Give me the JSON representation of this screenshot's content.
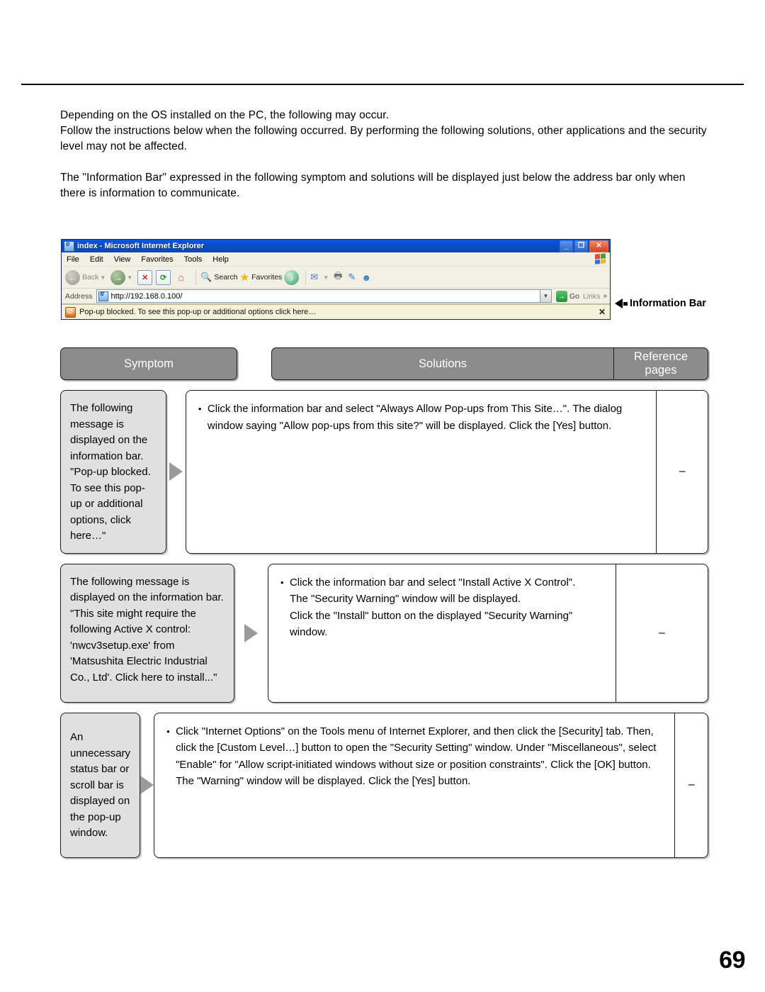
{
  "page": {
    "number": "69"
  },
  "intro": {
    "line1": "Depending on the OS installed on the PC, the following may occur.",
    "line2": "Follow the instructions below when the following occurred. By performing the following solutions, other applications and the security level may not be affected.",
    "line3": "The \"Information Bar\" expressed in the following symptom and solutions will be displayed just below the address bar only when there is information to communicate."
  },
  "browser": {
    "title": "index - Microsoft Internet Explorer",
    "window_buttons": {
      "minimize": "_",
      "restore": "❐",
      "close": "✕"
    },
    "menu": [
      "File",
      "Edit",
      "View",
      "Favorites",
      "Tools",
      "Help"
    ],
    "toolbar": {
      "back": "Back",
      "forward": "",
      "stop": "✕",
      "refresh": "⟳",
      "home": "⌂",
      "search": "Search",
      "favorites": "Favorites",
      "media": "",
      "mail": "✉",
      "print": "🖶",
      "edit": "✎",
      "messenger": "☻"
    },
    "address": {
      "label": "Address",
      "url": "http://192.168.0.100/",
      "dropdown": "▼",
      "go": "Go",
      "go_arrow": "→",
      "links": "Links",
      "chevron": "»"
    },
    "information_bar": {
      "message": "Pop-up blocked. To see this pop-up or additional options click here…",
      "close": "✕"
    }
  },
  "callout": {
    "label": "Information Bar"
  },
  "table": {
    "headers": {
      "symptom": "Symptom",
      "solutions": "Solutions",
      "reference_line1": "Reference",
      "reference_line2": "pages"
    },
    "rows": [
      {
        "symptom": "The following message is displayed on the information bar.\n\"Pop-up blocked. To see this pop-up or additional options, click here…\"",
        "solution": "Click the information bar and select \"Always Allow Pop-ups from This Site…\". The dialog window saying \"Allow pop-ups from this site?\" will be displayed. Click the [Yes] button.",
        "reference": "–"
      },
      {
        "symptom": "The following message is displayed on the information bar. \"This site might require the following Active X control: 'nwcv3setup.exe' from 'Matsushita Electric Industrial Co., Ltd'. Click here to install...\"",
        "solution": "Click the information bar and select \"Install Active X Control\".\nThe \"Security Warning\" window will be displayed.\nClick the \"Install\" button on the displayed \"Security Warning\" window.",
        "reference": "–"
      },
      {
        "symptom": "An unnecessary status bar or scroll bar is displayed on the pop-up window.",
        "solution": "Click \"Internet Options\" on the Tools menu of Internet Explorer, and then click the [Security] tab. Then, click the [Custom Level…] button to open the \"Security Setting\" window. Under \"Miscellaneous\", select \"Enable\" for \"Allow script-initiated windows without size or position constraints\". Click the [OK] button.\nThe \"Warning\" window will be displayed. Click the [Yes] button.",
        "reference": "–"
      }
    ]
  }
}
